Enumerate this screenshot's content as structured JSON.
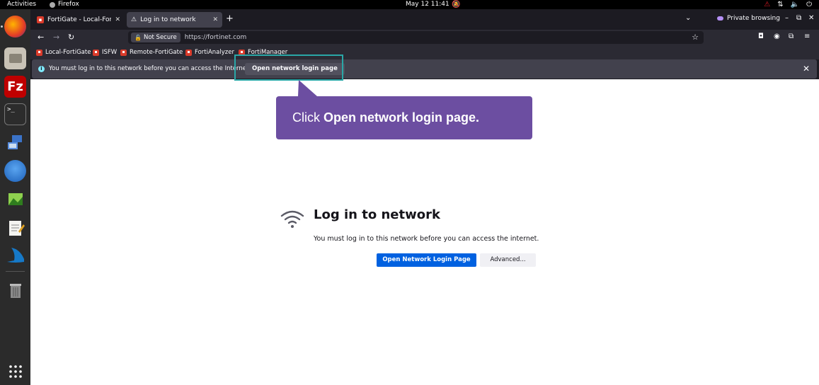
{
  "topbar": {
    "activities": "Activities",
    "app_name": "Firefox",
    "clock": "May 12  11:41"
  },
  "dock": {
    "apps": [
      "firefox",
      "file-manager",
      "filezilla",
      "terminal",
      "network-connections",
      "thunderbird",
      "image-viewer",
      "text-editor",
      "wireshark",
      "trash",
      "show-applications"
    ]
  },
  "tabs": [
    {
      "title": "FortiGate - Local-FortiGat",
      "active": false
    },
    {
      "title": "Log in to network",
      "active": true
    }
  ],
  "private_browsing": "Private browsing",
  "navbar": {
    "not_secure": "Not Secure",
    "url": "https://fortinet.com"
  },
  "bookmarks": [
    "Local-FortiGate",
    "ISFW",
    "Remote-FortiGate",
    "FortiAnalyzer",
    "FortiManager"
  ],
  "notification": {
    "text": "You must log in to this network before you can access the Internet.",
    "button": "Open network login page"
  },
  "callout": {
    "prefix": "Click ",
    "action": "Open network login page."
  },
  "page": {
    "heading": "Log in to network",
    "description": "You must log in to this network before you can access the internet.",
    "primary_button": "Open Network Login Page",
    "secondary_button": "Advanced..."
  },
  "colors": {
    "callout": "#6c4ea1",
    "highlight": "#2aa7a7",
    "primary": "#0061e0"
  }
}
